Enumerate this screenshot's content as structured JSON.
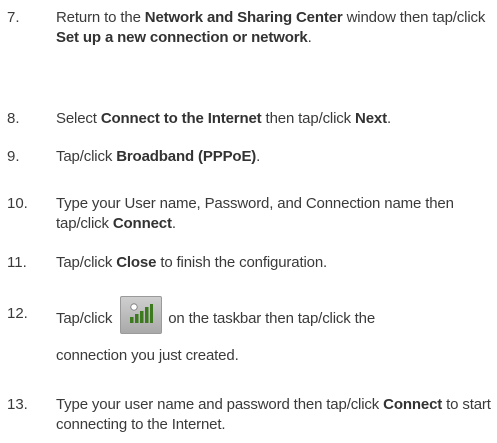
{
  "steps": [
    {
      "num": "7.",
      "parts": [
        "Return to the ",
        "Network and Sharing Center",
        " window then tap/click ",
        "Set up a new connection or network",
        "."
      ]
    },
    {
      "num": "8.",
      "parts": [
        "Select ",
        "Connect to the Internet",
        " then tap/click ",
        "Next",
        "."
      ]
    },
    {
      "num": "9.",
      "parts": [
        "Tap/click ",
        "Broadband (PPPoE)",
        "."
      ]
    },
    {
      "num": "10.",
      "parts": [
        "Type your User name, Password, and Connection name then tap/click ",
        "Connect",
        "."
      ]
    },
    {
      "num": "11.",
      "parts": [
        "Tap/click ",
        "Close",
        " to finish the configuration."
      ]
    },
    {
      "num": "12.",
      "parts": [
        "Tap/click ",
        "on the taskbar then tap/click the",
        "connection you just created."
      ]
    },
    {
      "num": "13.",
      "parts": [
        "Type your user name and password then tap/click ",
        "Connect",
        " to start connecting to the Internet."
      ]
    }
  ],
  "icons": {
    "network": "network-signal-icon"
  }
}
